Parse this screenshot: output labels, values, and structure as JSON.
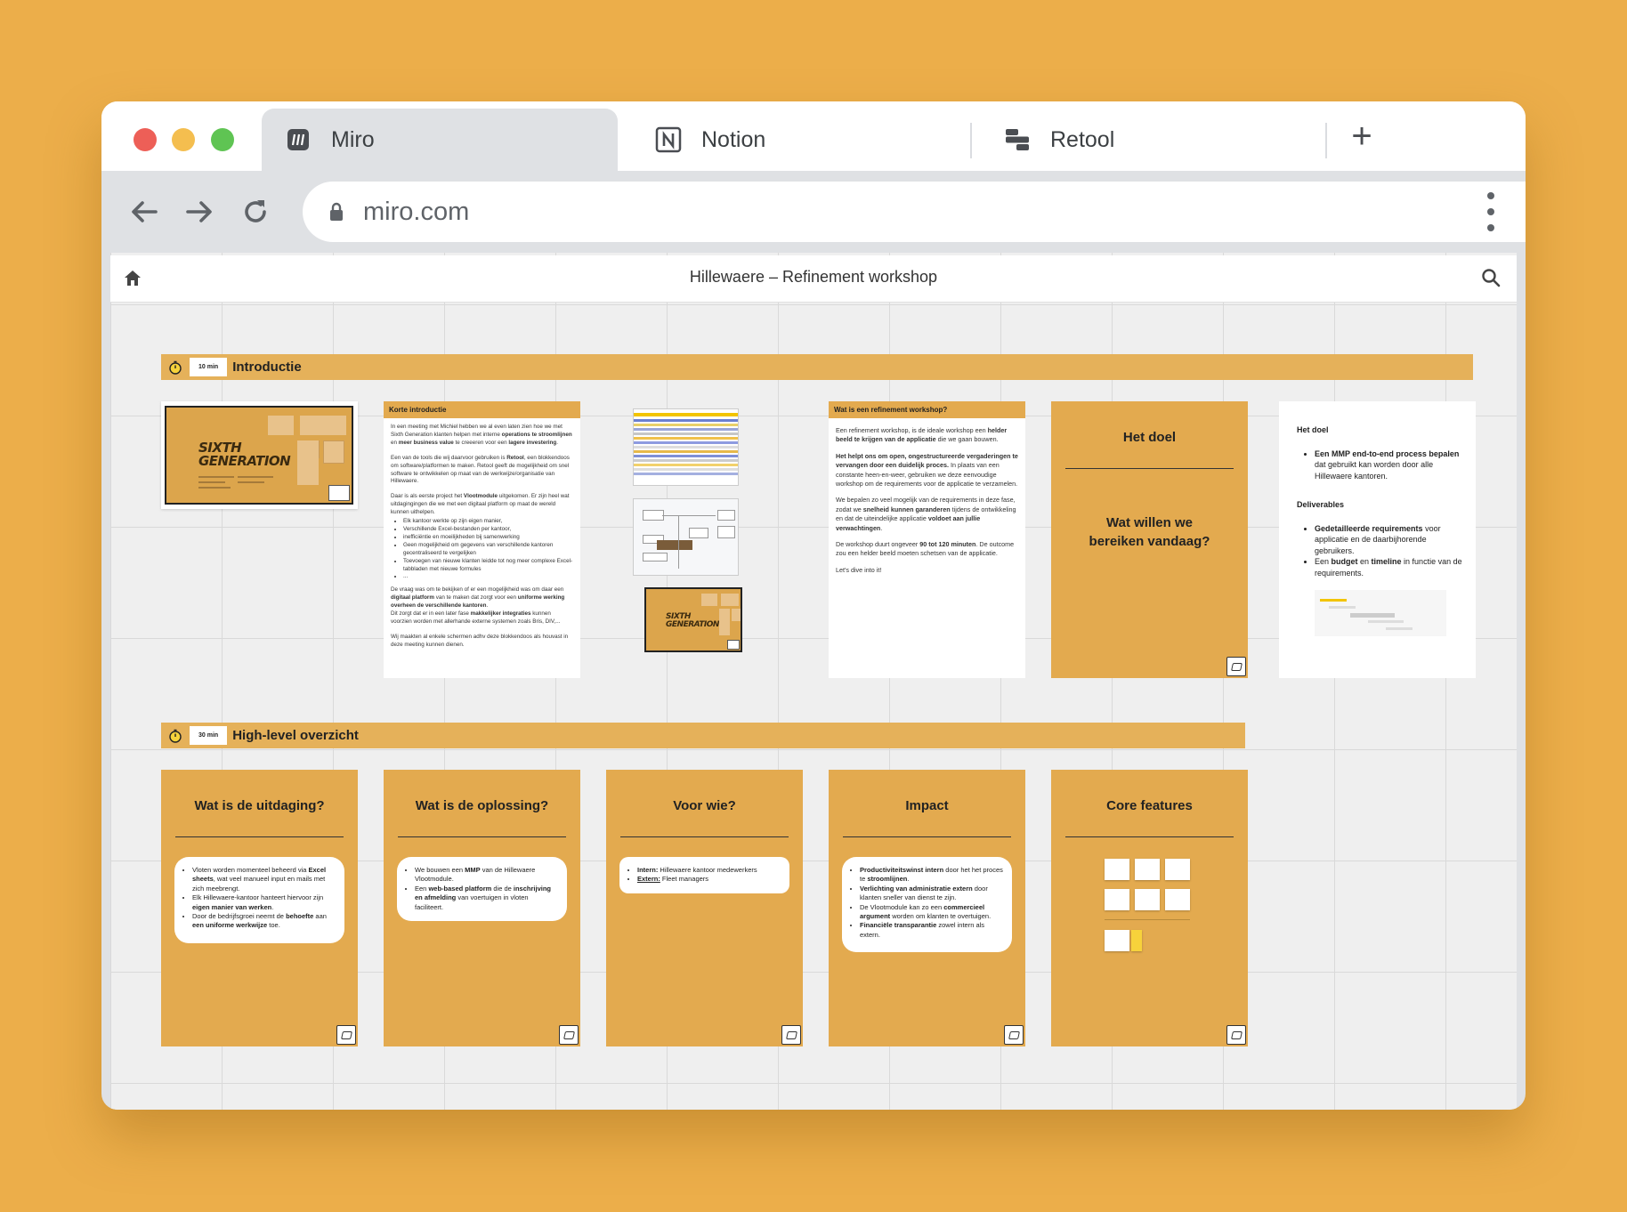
{
  "browser": {
    "tabs": [
      {
        "label": "Miro",
        "icon": "miro-icon",
        "active": true
      },
      {
        "label": "Notion",
        "icon": "notion-icon",
        "active": false
      },
      {
        "label": "Retool",
        "icon": "retool-icon",
        "active": false
      }
    ],
    "new_tab_label": "+",
    "address": "miro.com"
  },
  "board": {
    "title": "Hillewaere – Refinement workshop"
  },
  "sections": [
    {
      "time": "10 min",
      "title": "Introductie"
    },
    {
      "time": "30 min",
      "title": "High-level overzicht"
    }
  ],
  "intro": {
    "slide": {
      "logo_line1": "SIXTH",
      "logo_line2": "GENERATION"
    },
    "korte": {
      "header": "Korte introductie",
      "p1_a": "In een meeting met Michiel hebben we al even laten zien hoe we met Sixth Generation klanten helpen met interne ",
      "p1_b": "operations te stroomlijnen",
      "p1_c": " en ",
      "p1_d": "meer business value",
      "p1_e": " te creeeren voor een ",
      "p1_f": "lagere investering",
      "p1_g": ".",
      "p2_a": "Een van de tools die wij daarvoor gebruiken is ",
      "p2_b": "Retool",
      "p2_c": ", een blokkendoos om software/platformen te maken. Retool geeft de mogelijkheid om snel software te ontwikkelen op maat van de werkwijze/organisatie van Hillewaere.",
      "p3_a": "Daar is als eerste project het ",
      "p3_b": "Vlootmodule",
      "p3_c": " uitgekomen. Er zijn heel wat uitdagingingen die we met een digitaal platform op maat de wereld kunnen uithelpen.",
      "list": [
        "Elk kantoor werkte op zijn eigen manier,",
        "Verschillende Excel-bestanden per kantoor,",
        "inefficiëntie en moeilijkheden bij samenwerking",
        "Geen mogelijkheid om gegevens van verschillende kantoren gecentraliseerd te vergelijken",
        "Toevoegen van nieuwe klanten leidde tot nog meer complexe Excel-tabbladen met nieuwe formules",
        "..."
      ],
      "p4_a": "De vraag was om te bekijken of er een mogelijkheid was om daar een ",
      "p4_b": "digitaal platform",
      "p4_c": " van te maken dat zorgt voor een ",
      "p4_d": "uniforme werking overheen de verschillende kantoren",
      "p4_e": ".",
      "p5_a": "Dit zorgt dat er in een later fase ",
      "p5_b": "makkelijker integraties",
      "p5_c": " kunnen voorzien worden met allerhande externe systemen zoals Bris, DIV,...",
      "p6": "Wij maakten al enkele schermen adhv deze blokkendoos als houvast in deze meeting kunnen dienen."
    },
    "refinement": {
      "header": "Wat is een refinement workshop?",
      "p1_a": "Een refinement workshop, is de ideale workshop een ",
      "p1_b": "helder beeld te krijgen van de applicatie",
      "p1_c": " die we gaan bouwen.",
      "p2_a": "Het helpt ons om open, ongestructureerde vergaderingen te vervangen door een duidelijk proces.",
      "p2_b": " In plaats van een constante heen-en-weer, gebruiken we deze eenvoudige workshop om de requirements voor de applicatie te verzamelen.",
      "p3_a": "We bepalen zo veel mogelijk van de requirements in deze fase, zodat we ",
      "p3_b": "snelheid kunnen garanderen",
      "p3_c": " tijdens de ontwikkeling en dat de uiteindelijke applicatie ",
      "p3_d": "voldoet aan jullie verwachtingen",
      "p3_e": ".",
      "p4_a": "De workshop duurt ongeveer ",
      "p4_b": "90 tot 120 minuten",
      "p4_c": ". De outcome zou een helder beeld moeten schetsen van de applicatie.",
      "p5": "Let's dive into it!"
    },
    "doel": {
      "title": "Het doel",
      "question": "Wat willen we bereiken vandaag?"
    },
    "doel_text": {
      "heading1": "Het doel",
      "item1_a": "Een MMP end-to-end process bepalen",
      "item1_b": " dat gebruikt kan worden door alle Hillewaere kantoren.",
      "heading2": "Deliverables",
      "item2_a": "Gedetailleerde requirements",
      "item2_b": " voor applicatie en de daarbijhorende gebruikers.",
      "item3_a": "Een ",
      "item3_b": "budget",
      "item3_c": " en ",
      "item3_d": "timeline",
      "item3_e": " in functie van de requirements."
    }
  },
  "overview": {
    "uitdaging": {
      "title": "Wat is de uitdaging?",
      "b1_a": "Vloten worden momenteel beheerd via ",
      "b1_b": "Excel sheets",
      "b1_c": ", wat veel manueel input en mails met zich meebrengt.",
      "b2_a": "Elk Hillewaere-kantoor hanteert hiervoor zijn ",
      "b2_b": "eigen manier van werken",
      "b2_c": ".",
      "b3_a": "Door de bedrijfsgroei neemt de ",
      "b3_b": "behoefte",
      "b3_c": " aan ",
      "b3_d": "een uniforme werkwijze",
      "b3_e": " toe."
    },
    "oplossing": {
      "title": "Wat is de oplossing?",
      "b1_a": "We bouwen een ",
      "b1_b": "MMP",
      "b1_c": " van de Hillewaere Vlootmodule.",
      "b2_a": "Een ",
      "b2_b": "web-based platform",
      "b2_c": " die de ",
      "b2_d": "inschrijving en afmelding",
      "b2_e": " van voertuigen in vloten faciliteert."
    },
    "voorwie": {
      "title": "Voor wie?",
      "b1_a": "Intern:",
      "b1_b": " Hillewaere kantoor medewerkers",
      "b2_a": "Extern:",
      "b2_b": " Fleet managers"
    },
    "impact": {
      "title": "Impact",
      "b1_a": "Productiviteitswinst intern",
      "b1_b": " door het het proces te ",
      "b1_c": "stroomlijnen",
      "b1_d": ".",
      "b2_a": "Verlichting van administratie extern",
      "b2_b": " door klanten sneller van dienst te zijn.",
      "b3_a": "De Vlootmodule kan zo een ",
      "b3_b": "commercieel argument",
      "b3_c": " worden om klanten te overtuigen.",
      "b4_a": "Financiële transparantie",
      "b4_b": " zowel intern als extern."
    },
    "core": {
      "title": "Core features"
    }
  },
  "colors": {
    "background": "#ecae4a",
    "section_bar": "#e5b15a",
    "card": "#e3aa4f",
    "traffic_red": "#ed5f57",
    "traffic_yellow": "#f4be4f",
    "traffic_green": "#5fc453"
  }
}
